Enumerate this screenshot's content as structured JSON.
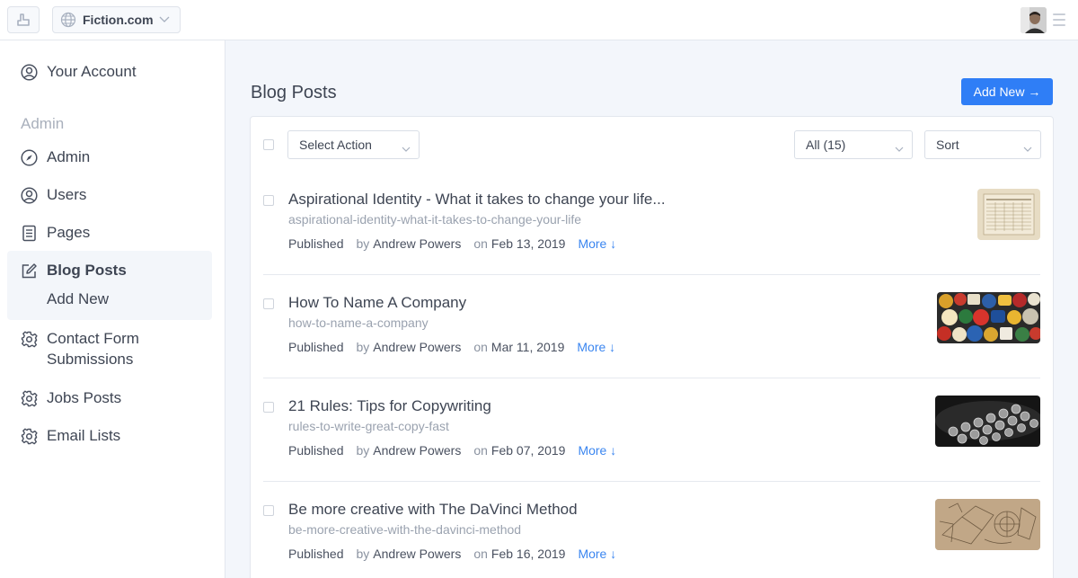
{
  "topbar": {
    "site_name": "Fiction.com"
  },
  "sidebar": {
    "account_label": "Your Account",
    "section_label": "Admin",
    "items": [
      {
        "label": "Admin",
        "icon": "compass-icon"
      },
      {
        "label": "Users",
        "icon": "user-circle-icon"
      },
      {
        "label": "Pages",
        "icon": "document-icon"
      },
      {
        "label": "Blog Posts",
        "icon": "edit-icon"
      },
      {
        "label": "Contact Form",
        "label2": "Submissions",
        "icon": "gear-icon"
      },
      {
        "label": "Jobs Posts",
        "icon": "gear-icon"
      },
      {
        "label": "Email Lists",
        "icon": "gear-icon"
      }
    ],
    "sub_item": "Add New"
  },
  "main": {
    "title": "Blog Posts",
    "add_new_label": "Add New →",
    "toolbar": {
      "action_select": "Select Action",
      "filter_select": "All (15)",
      "sort_select": "Sort"
    },
    "posts": [
      {
        "title": "Aspirational Identity - What it takes to change your life...",
        "slug": "aspirational-identity-what-it-takes-to-change-your-life",
        "status": "Published",
        "by": "by",
        "author": "Andrew Powers",
        "on": "on",
        "date": "Feb 13, 2019",
        "more": "More ↓"
      },
      {
        "title": "How To Name A Company",
        "slug": "how-to-name-a-company",
        "status": "Published",
        "by": "by",
        "author": "Andrew Powers",
        "on": "on",
        "date": "Mar 11, 2019",
        "more": "More ↓"
      },
      {
        "title": "21 Rules: Tips for Copywriting",
        "slug": "rules-to-write-great-copy-fast",
        "status": "Published",
        "by": "by",
        "author": "Andrew Powers",
        "on": "on",
        "date": "Feb 07, 2019",
        "more": "More ↓"
      },
      {
        "title": "Be more creative with The DaVinci Method",
        "slug": "be-more-creative-with-the-davinci-method",
        "status": "Published",
        "by": "by",
        "author": "Andrew Powers",
        "on": "on",
        "date": "Feb 16, 2019",
        "more": "More ↓"
      }
    ]
  },
  "colors": {
    "accent": "#2f7ef6",
    "link": "#3b86f0",
    "background": "#f3f6fb"
  }
}
